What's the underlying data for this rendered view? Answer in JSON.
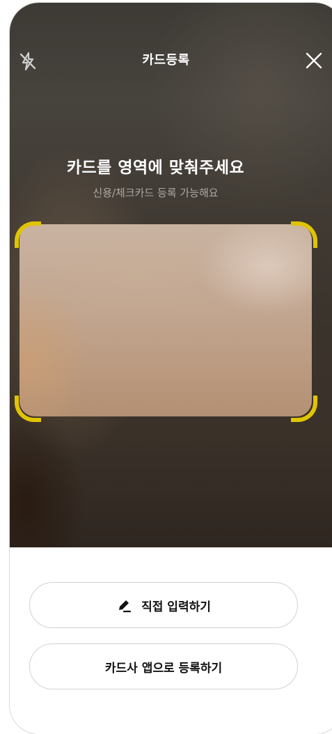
{
  "header": {
    "title": "카드등록",
    "flash_icon": "flash-off-icon",
    "close_icon": "close-icon"
  },
  "guide": {
    "headline": "카드를 영역에 맞춰주세요",
    "subtext": "신용/체크카드 등록 가능해요"
  },
  "colors": {
    "frame_corner": "#e0c400",
    "text_on_camera": "#ffffff",
    "button_border": "#d2d2d2"
  },
  "actions": {
    "manual_entry_label": "직접 입력하기",
    "manual_entry_icon": "pencil-icon",
    "card_app_label": "카드사 앱으로 등록하기"
  }
}
